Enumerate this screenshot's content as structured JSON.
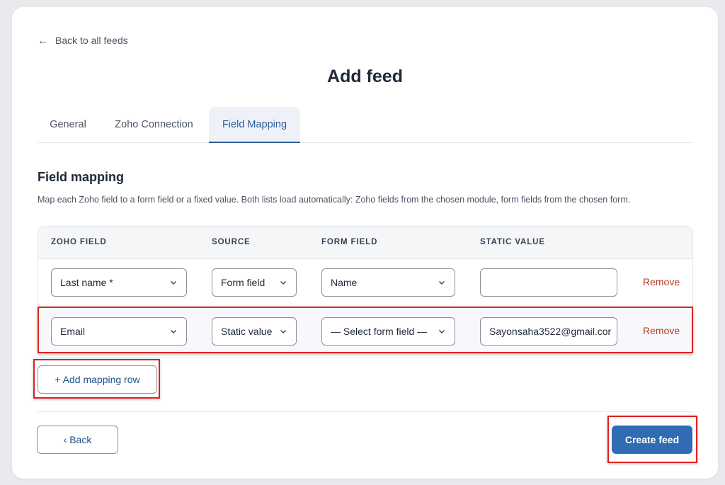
{
  "nav": {
    "back_label": "Back to all feeds"
  },
  "page": {
    "title": "Add feed"
  },
  "tabs": [
    {
      "label": "General",
      "active": false
    },
    {
      "label": "Zoho Connection",
      "active": false
    },
    {
      "label": "Field Mapping",
      "active": true
    }
  ],
  "section": {
    "title": "Field mapping",
    "description": "Map each Zoho field to a form field or a fixed value. Both lists load automatically: Zoho fields from the chosen module, form fields from the chosen form."
  },
  "table": {
    "headers": [
      "ZOHO FIELD",
      "SOURCE",
      "FORM FIELD",
      "STATIC VALUE"
    ],
    "rows": [
      {
        "zoho_field": "Last name *",
        "source": "Form field",
        "form_field": "Name",
        "static_value": "",
        "remove_label": "Remove"
      },
      {
        "zoho_field": "Email",
        "source": "Static value",
        "form_field": "— Select form field —",
        "static_value": "Sayonsaha3522@gmail.cor",
        "remove_label": "Remove"
      }
    ]
  },
  "actions": {
    "add_row_label": "+ Add mapping row",
    "back_label": "‹ Back",
    "create_label": "Create feed"
  },
  "colors": {
    "accent": "#2a5d94",
    "primary_button": "#2f6cb3",
    "remove_link": "#b83a2a",
    "highlight_box": "#e02020"
  }
}
